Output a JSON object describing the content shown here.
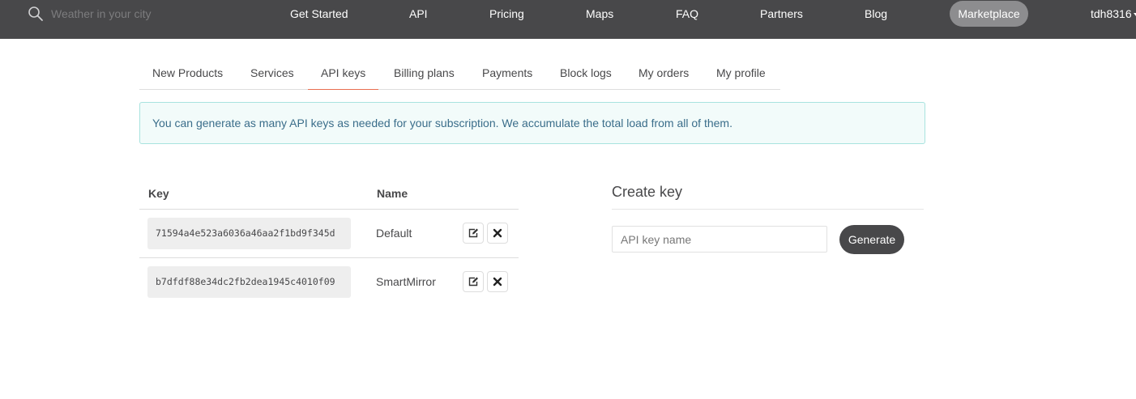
{
  "navbar": {
    "search_placeholder": "Weather in your city",
    "links": [
      "Get Started",
      "API",
      "Pricing",
      "Maps",
      "FAQ",
      "Partners",
      "Blog"
    ],
    "marketplace_label": "Marketplace",
    "username": "tdh8316",
    "colors": {
      "background": "#48484a",
      "pill": "#8d8d8f",
      "text": "#ffffff"
    }
  },
  "tabs": {
    "items": [
      "New Products",
      "Services",
      "API keys",
      "Billing plans",
      "Payments",
      "Block logs",
      "My orders",
      "My profile"
    ],
    "active": "API keys",
    "active_color": "#e96e50"
  },
  "alert": {
    "message": "You can generate as many API keys as needed for your subscription. We accumulate the total load from all of them."
  },
  "keys_table": {
    "headers": {
      "key": "Key",
      "name": "Name"
    },
    "rows": [
      {
        "key": "71594a4e523a6036a46aa2f1bd9f345d",
        "name": "Default",
        "actions": [
          "edit-icon",
          "delete-icon"
        ]
      },
      {
        "key": "b7dfdf88e34dc2fb2dea1945c4010f09",
        "name": "SmartMirror",
        "actions": [
          "edit-icon",
          "delete-icon"
        ]
      }
    ]
  },
  "create_key": {
    "title": "Create key",
    "input_placeholder": "API key name",
    "button_label": "Generate"
  }
}
